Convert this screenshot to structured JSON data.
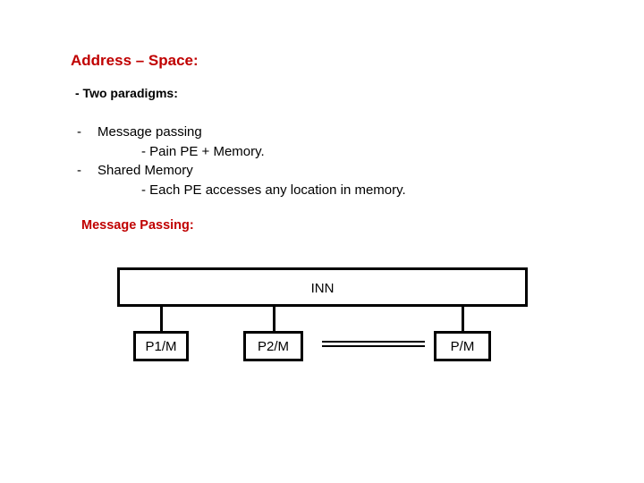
{
  "heading": {
    "title": "Address – Space:",
    "subtitle": "- Two paradigms:"
  },
  "paradigms": [
    {
      "bullet": "-",
      "label": "Message passing",
      "detail": "- Pain PE + Memory."
    },
    {
      "bullet": "-",
      "label": "Shared Memory",
      "detail": "- Each PE accesses any location in memory."
    }
  ],
  "section": {
    "title": "Message Passing:"
  },
  "diagram": {
    "network_label": "INN",
    "nodes": [
      "P1/M",
      "P2/M",
      "P/M"
    ],
    "ellipsis": "double-line"
  },
  "colors": {
    "accent": "#c00000",
    "text": "#000000",
    "background": "#ffffff"
  }
}
